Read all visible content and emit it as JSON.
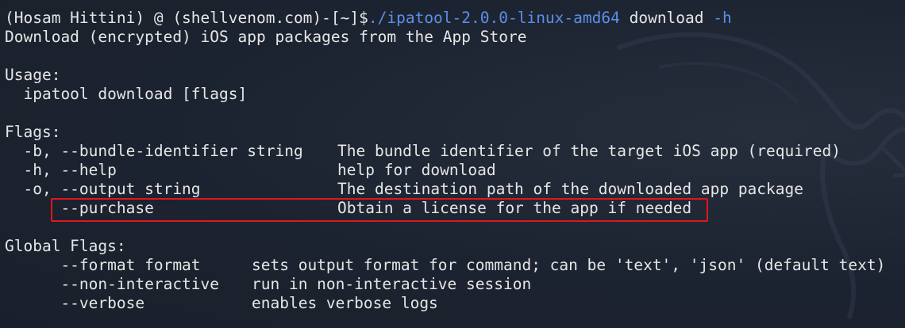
{
  "prompt": {
    "identity": "(Hosam Hittini) @ (shellvenom.com)-[~]$",
    "command_path": "./ipatool-2.0.0-linux-amd64",
    "command_arg": " download ",
    "command_flag": "-h"
  },
  "description": "Download (encrypted) iOS app packages from the App Store",
  "usage": {
    "heading": "Usage:",
    "line": "  ipatool download [flags]"
  },
  "flags": {
    "heading": "Flags:",
    "items": [
      {
        "name": "  -b, --bundle-identifier string",
        "desc": "The bundle identifier of the target iOS app (required)"
      },
      {
        "name": "  -h, --help",
        "desc": "help for download"
      },
      {
        "name": "  -o, --output string",
        "desc": "The destination path of the downloaded app package"
      },
      {
        "name": "      --purchase",
        "desc": "Obtain a license for the app if needed"
      }
    ]
  },
  "global_flags": {
    "heading": "Global Flags:",
    "items": [
      {
        "name": "      --format format",
        "desc": "sets output format for command; can be 'text', 'json' (default text)"
      },
      {
        "name": "      --non-interactive",
        "desc": "run in non-interactive session"
      },
      {
        "name": "      --verbose",
        "desc": "enables verbose logs"
      }
    ]
  },
  "colors": {
    "background": "#1c2330",
    "text": "#e6e6e6",
    "command_accent": "#5b8fe8",
    "highlight_box": "#e0161d"
  }
}
